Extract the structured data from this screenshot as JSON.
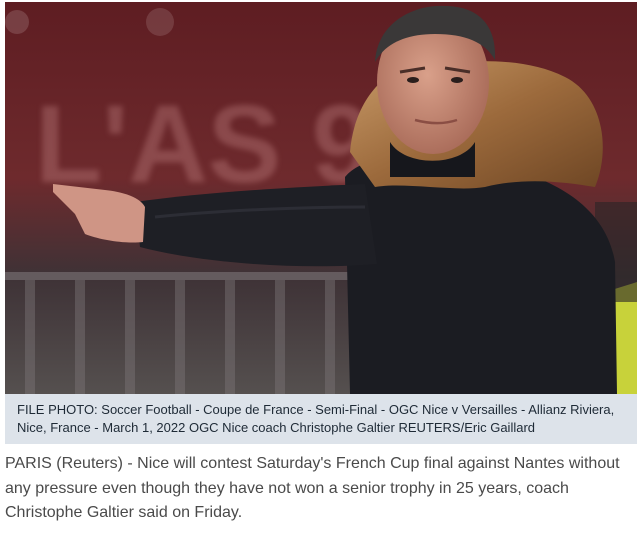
{
  "photo": {
    "alt": "Christophe Galtier pointing on the touchline",
    "background_text": "L'AS 95"
  },
  "caption": {
    "text": "FILE PHOTO: Soccer Football - Coupe de France - Semi-Final - OGC Nice v Versailles - Allianz Riviera, Nice, France - March 1, 2022 OGC Nice coach Christophe Galtier REUTERS/Eric Gaillard"
  },
  "article": {
    "paragraph_1": "PARIS (Reuters) - Nice will contest Saturday's French Cup final against Nantes without any pressure even though they have not won a senior trophy in 25 years, coach Christophe Galtier said on Friday."
  },
  "colors": {
    "caption_background": "#dde3ea",
    "caption_text": "#1e2a36",
    "article_text": "#4a4a4a"
  }
}
